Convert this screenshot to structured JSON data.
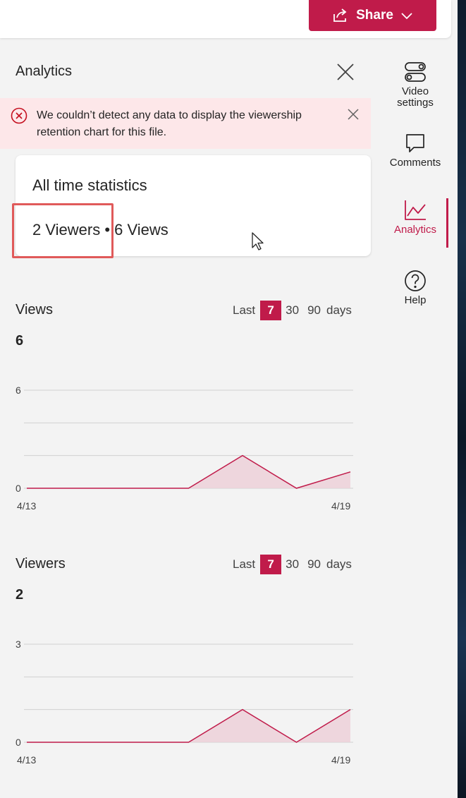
{
  "toolbar": {
    "share_label": "Share"
  },
  "panel": {
    "title": "Analytics"
  },
  "error": {
    "message": "We couldn’t detect any data to display the viewership retention chart for this file."
  },
  "stats": {
    "title": "All time statistics",
    "viewers": "2 Viewers",
    "separator": "•",
    "views": "6 Views"
  },
  "views_section": {
    "title": "Views",
    "total": "6",
    "range": {
      "last": "Last",
      "options": [
        "7",
        "30",
        "90"
      ],
      "selected": "7",
      "days": "days"
    }
  },
  "viewers_section": {
    "title": "Viewers",
    "total": "2",
    "range": {
      "last": "Last",
      "options": [
        "7",
        "30",
        "90"
      ],
      "selected": "7",
      "days": "days"
    }
  },
  "sidebar": {
    "items": [
      {
        "label": "Video settings",
        "icon": "toggle-settings-icon"
      },
      {
        "label": "Comments",
        "icon": "comment-icon"
      },
      {
        "label": "Analytics",
        "icon": "chart-line-icon",
        "active": true
      },
      {
        "label": "Help",
        "icon": "help-icon"
      }
    ]
  },
  "colors": {
    "accent": "#c01b4a",
    "error_bg": "#fde7e9",
    "fill": "#ecd0d8"
  },
  "chart_data": [
    {
      "type": "area",
      "x": [
        "4/13",
        "4/14",
        "4/15",
        "4/16",
        "4/17",
        "4/18",
        "4/19"
      ],
      "x_tick_labels": [
        "4/13",
        "4/19"
      ],
      "values": [
        0,
        0,
        0,
        0,
        2,
        0,
        1
      ],
      "ylim": [
        0,
        6
      ],
      "y_tick_labels": [
        "0",
        "6"
      ],
      "grid": true
    },
    {
      "type": "area",
      "x": [
        "4/13",
        "4/14",
        "4/15",
        "4/16",
        "4/17",
        "4/18",
        "4/19"
      ],
      "x_tick_labels": [
        "4/13",
        "4/19"
      ],
      "values": [
        0,
        0,
        0,
        0,
        1,
        0,
        1
      ],
      "ylim": [
        0,
        3
      ],
      "y_tick_labels": [
        "0",
        "3"
      ],
      "grid": true
    }
  ]
}
